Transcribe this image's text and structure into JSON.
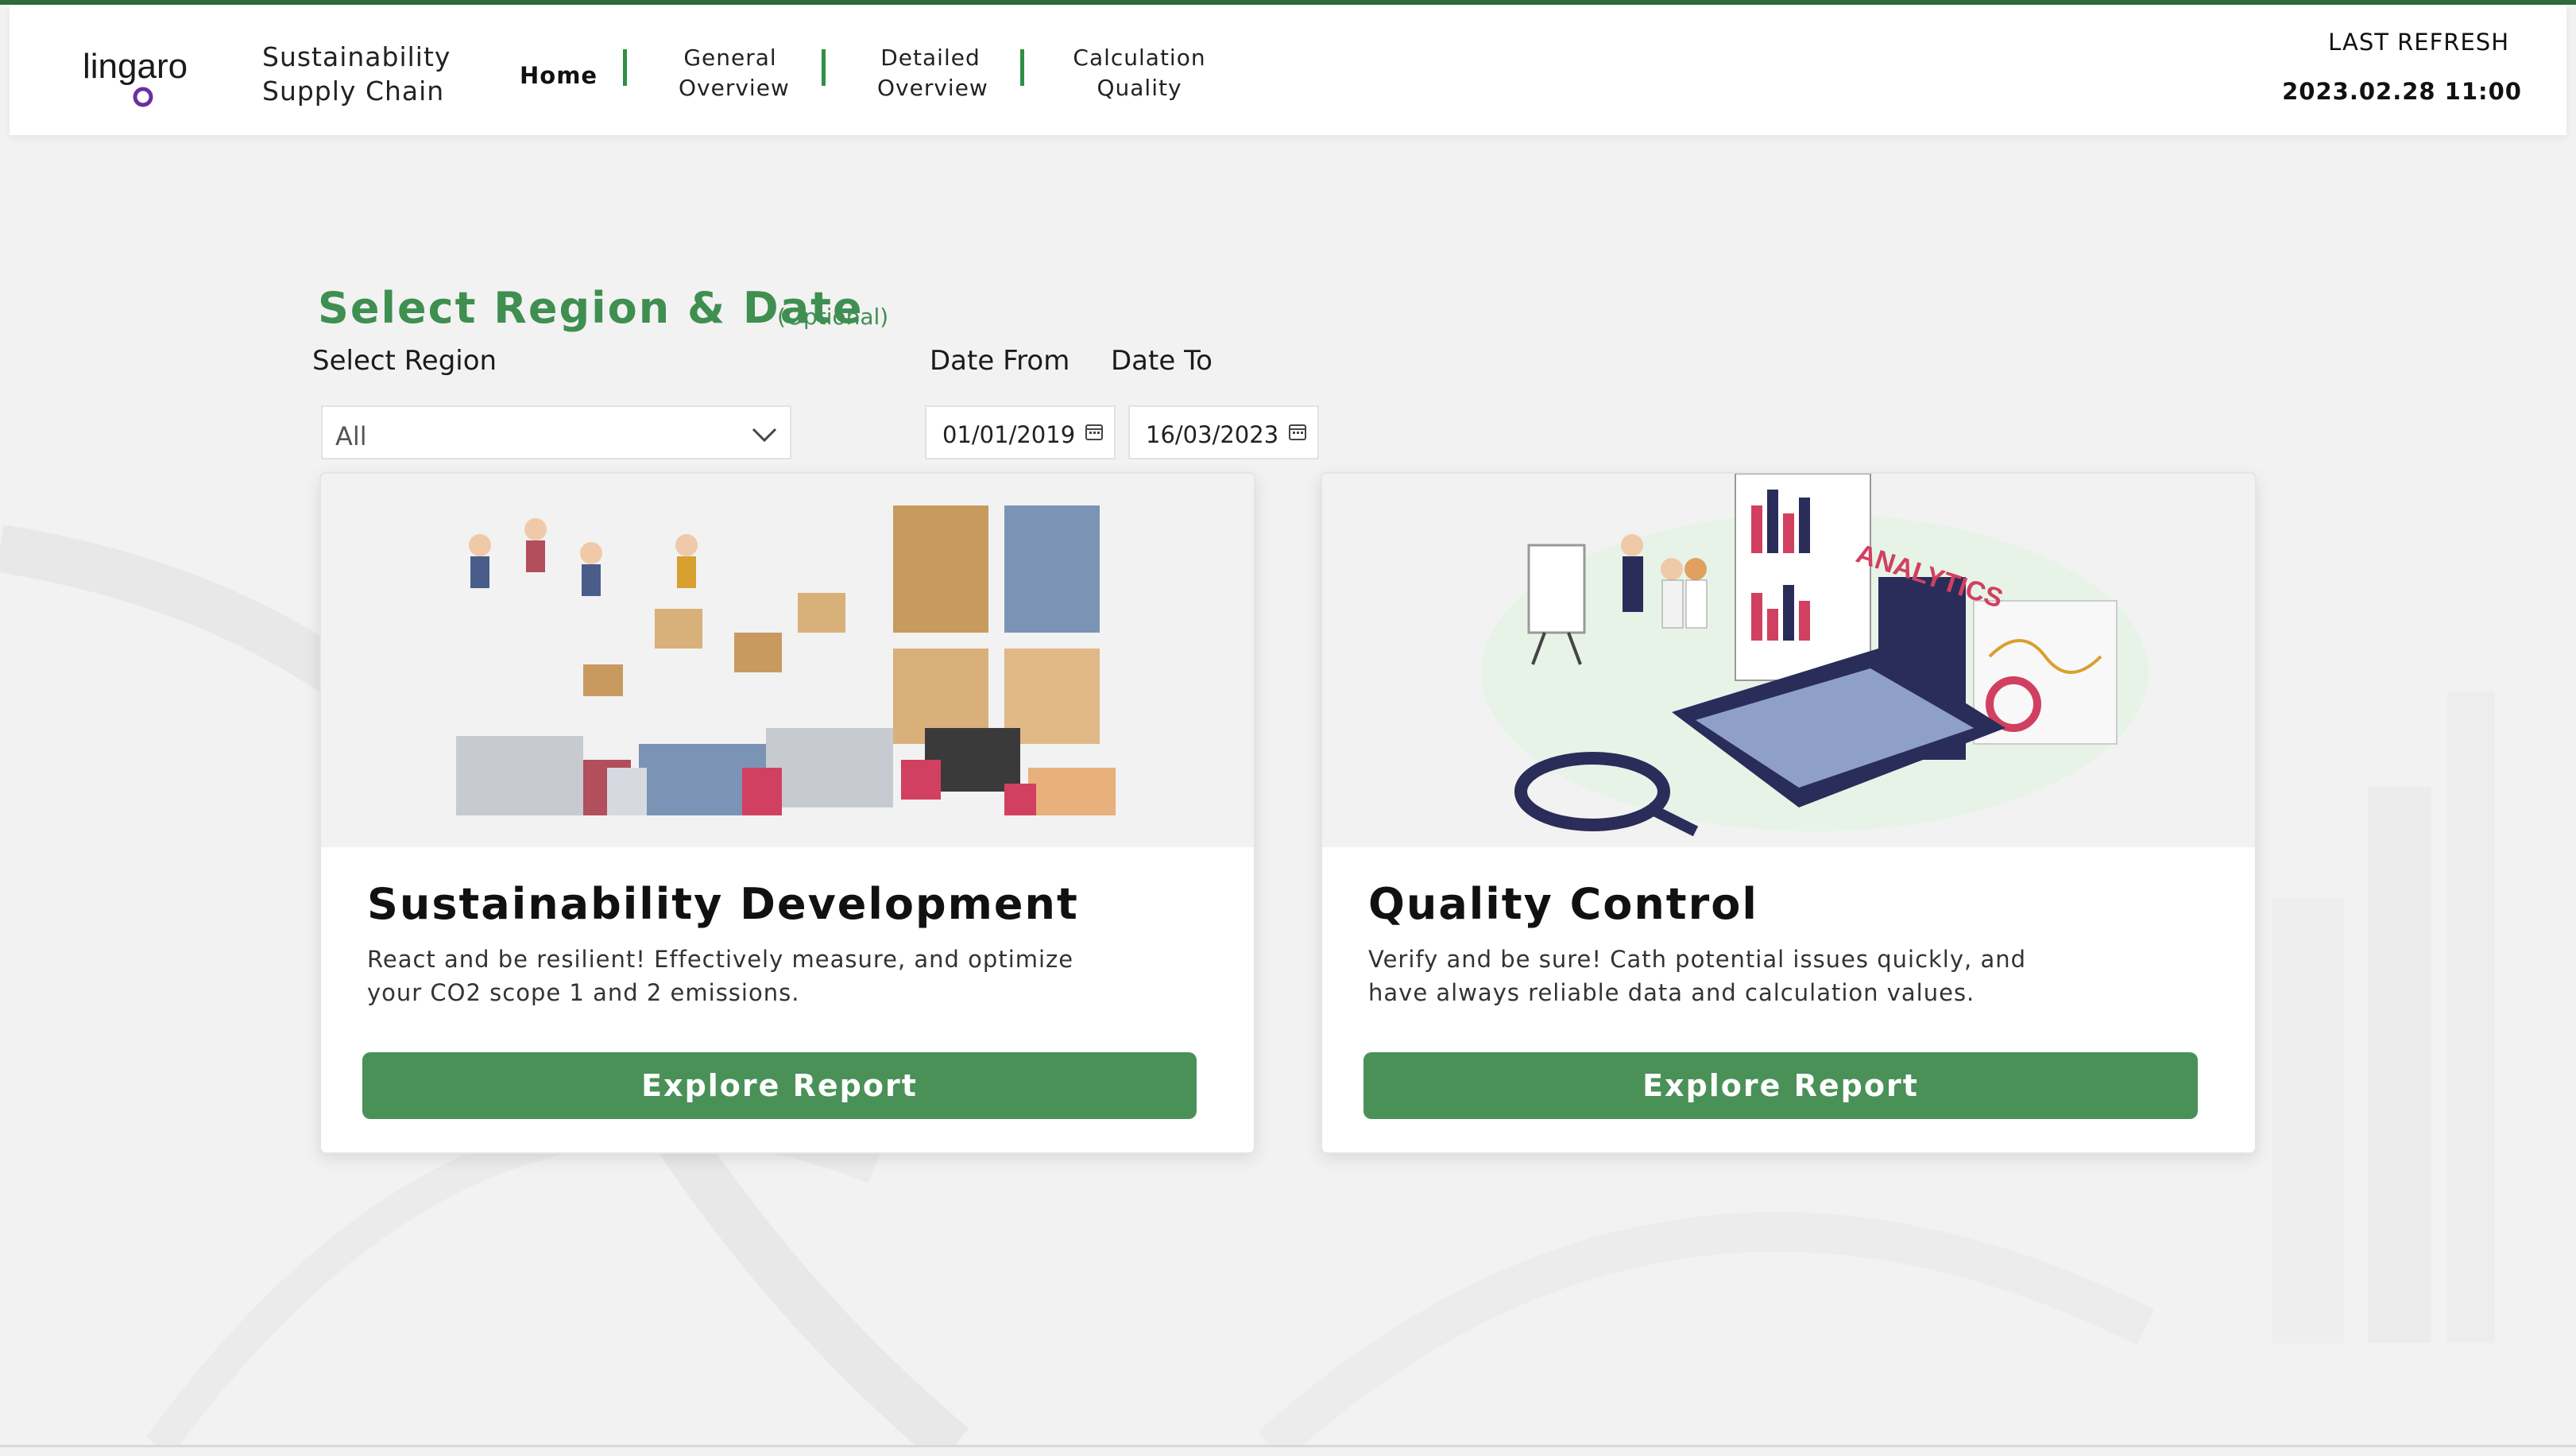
{
  "header": {
    "brand": "lingaro",
    "app_title_line1": "Sustainability",
    "app_title_line2": "Supply Chain",
    "nav": {
      "home": "Home",
      "general_line1": "General",
      "general_line2": "Overview",
      "detailed_line1": "Detailed",
      "detailed_line2": "Overview",
      "calc_line1": "Calculation",
      "calc_line2": "Quality"
    },
    "last_refresh_label": "LAST REFRESH",
    "last_refresh_value": "2023.02.28 11:00"
  },
  "filters": {
    "title": "Select Region & Date",
    "optional": "(Optional)",
    "region_label": "Select Region",
    "region_value": "All",
    "date_from_label": "Date From",
    "date_to_label": "Date To",
    "date_from": "01/01/2019",
    "date_to": "16/03/2023"
  },
  "cards": [
    {
      "illustration_word": "",
      "title": "Sustainability Development",
      "desc_line1": "React and be resilient! Effectively measure, and optimize",
      "desc_line2": "your CO2 scope 1 and 2 emissions.",
      "button": "Explore Report"
    },
    {
      "illustration_word": "ANALYTICS",
      "title": "Quality Control",
      "desc_line1": "Verify and be sure! Cath potential issues quickly, and",
      "desc_line2": "have always reliable data and calculation values.",
      "button": "Explore Report"
    }
  ],
  "colors": {
    "accent_green": "#3f8f50",
    "button_green": "#4a9158",
    "nav_separator": "#2f8f46",
    "logo_purple": "#6b2fa0"
  },
  "icons": [
    "chevron-down-icon",
    "calendar-icon",
    "magnifier-icon"
  ]
}
